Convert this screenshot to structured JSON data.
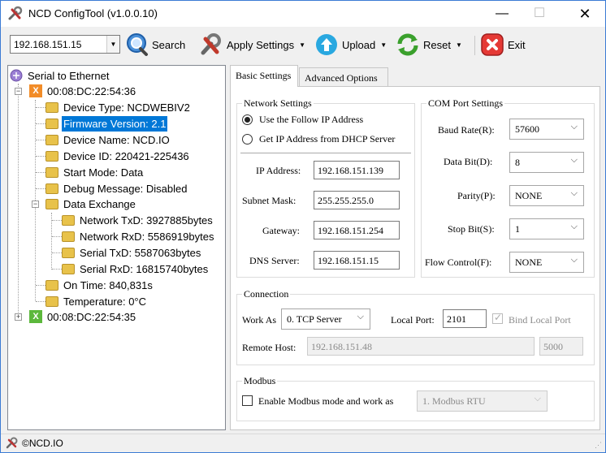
{
  "window": {
    "title": "NCD ConfigTool (v1.0.0.10)",
    "min_glyph": "—",
    "max_glyph": "☐",
    "close_glyph": "✕"
  },
  "toolbar": {
    "ip_value": "192.168.151.15",
    "search_label": "Search",
    "apply_label": "Apply Settings",
    "upload_label": "Upload",
    "reset_label": "Reset",
    "exit_label": "Exit"
  },
  "tree": {
    "root_label": "Serial to Ethernet",
    "device1": {
      "label": "00:08:DC:22:54:36",
      "badge": "X",
      "device_type": "Device Type: NCDWEBIV2",
      "firmware": "Firmware Version: 2.1",
      "device_name": "Device Name: NCD.IO",
      "device_id": "Device ID: 220421-225436",
      "start_mode": "Start Mode: Data",
      "debug": "Debug Message: Disabled",
      "data_exchange": "Data Exchange",
      "net_tx": "Network TxD: 3927885bytes",
      "net_rx": "Network RxD: 5586919bytes",
      "ser_tx": "Serial TxD: 5587063bytes",
      "ser_rx": "Serial RxD: 16815740bytes",
      "on_time": "On Time: 840,831s",
      "temperature": "Temperature: 0°C"
    },
    "device2": {
      "label": "00:08:DC:22:54:35",
      "badge": "X"
    }
  },
  "tabs": {
    "basic": "Basic Settings",
    "advanced": "Advanced Options"
  },
  "network": {
    "group_title": "Network Settings",
    "use_follow_ip": "Use the Follow IP Address",
    "use_dhcp": "Get IP Address from DHCP Server",
    "ip_label": "IP Address:",
    "ip_value": "192.168.151.139",
    "mask_label": "Subnet Mask:",
    "mask_value": "255.255.255.0",
    "gateway_label": "Gateway:",
    "gateway_value": "192.168.151.254",
    "dns_label": "DNS Server:",
    "dns_value": "192.168.151.15"
  },
  "com": {
    "group_title": "COM Port Settings",
    "baud_label": "Baud Rate(R):",
    "baud_value": "57600",
    "databit_label": "Data Bit(D):",
    "databit_value": "8",
    "parity_label": "Parity(P):",
    "parity_value": "NONE",
    "stopbit_label": "Stop Bit(S):",
    "stopbit_value": "1",
    "flow_label": "Flow Control(F):",
    "flow_value": "NONE"
  },
  "connection": {
    "group_title": "Connection",
    "work_as_label": "Work As",
    "work_as_value": "0. TCP Server",
    "local_port_label": "Local Port:",
    "local_port_value": "2101",
    "bind_label": "Bind Local Port",
    "remote_host_label": "Remote Host:",
    "remote_host_value": "192.168.151.48",
    "remote_port_value": "5000"
  },
  "modbus": {
    "group_title": "Modbus",
    "enable_label": "Enable Modbus mode and work as",
    "mode_value": "1. Modbus RTU"
  },
  "status": {
    "text": "©NCD.IO"
  },
  "colors": {
    "selection": "#0078d7",
    "badge_orange": "#f28c28",
    "badge_green": "#5cb83c",
    "folder": "#e8c24a"
  }
}
